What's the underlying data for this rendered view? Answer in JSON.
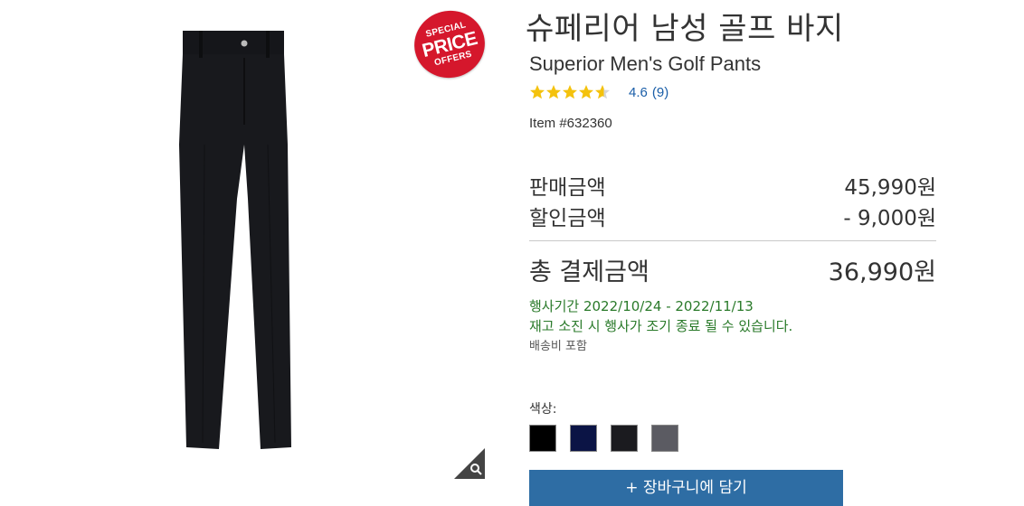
{
  "badge": {
    "line1": "SPECIAL",
    "line2": "PRICE",
    "line3": "OFFERS",
    "color": "#d5172c"
  },
  "product": {
    "title_ko": "슈페리어 남성 골프 바지",
    "title_en": "Superior Men's Golf Pants",
    "rating_value": "4.6",
    "review_count": "(9)",
    "stars": 4.6,
    "item_number": "Item #632360",
    "image_icon": "pants-image",
    "zoom_icon": "magnifier-icon"
  },
  "pricing": {
    "sale_label": "판매금액",
    "sale_price": "45,990원",
    "discount_label": "할인금액",
    "discount": "- 9,000원",
    "total_label": "총 결제금액",
    "total": "36,990원"
  },
  "event": {
    "period": "행사기간 2022/10/24 - 2022/11/13",
    "notice": "재고 소진 시 행사가 조기 종료 될 수 있습니다.",
    "shipping": "배송비 포함"
  },
  "color_options": {
    "label": "색상:",
    "swatches": [
      "#000000",
      "#0b1445",
      "#1b1b1f",
      "#5b5b62"
    ]
  },
  "cart": {
    "label": "+ 장바구니에 담기",
    "color": "#2e6da4"
  },
  "colors": {
    "accent_link": "#1a5ea8",
    "event_green": "#2a7a2a",
    "star": "#f4c20d"
  }
}
